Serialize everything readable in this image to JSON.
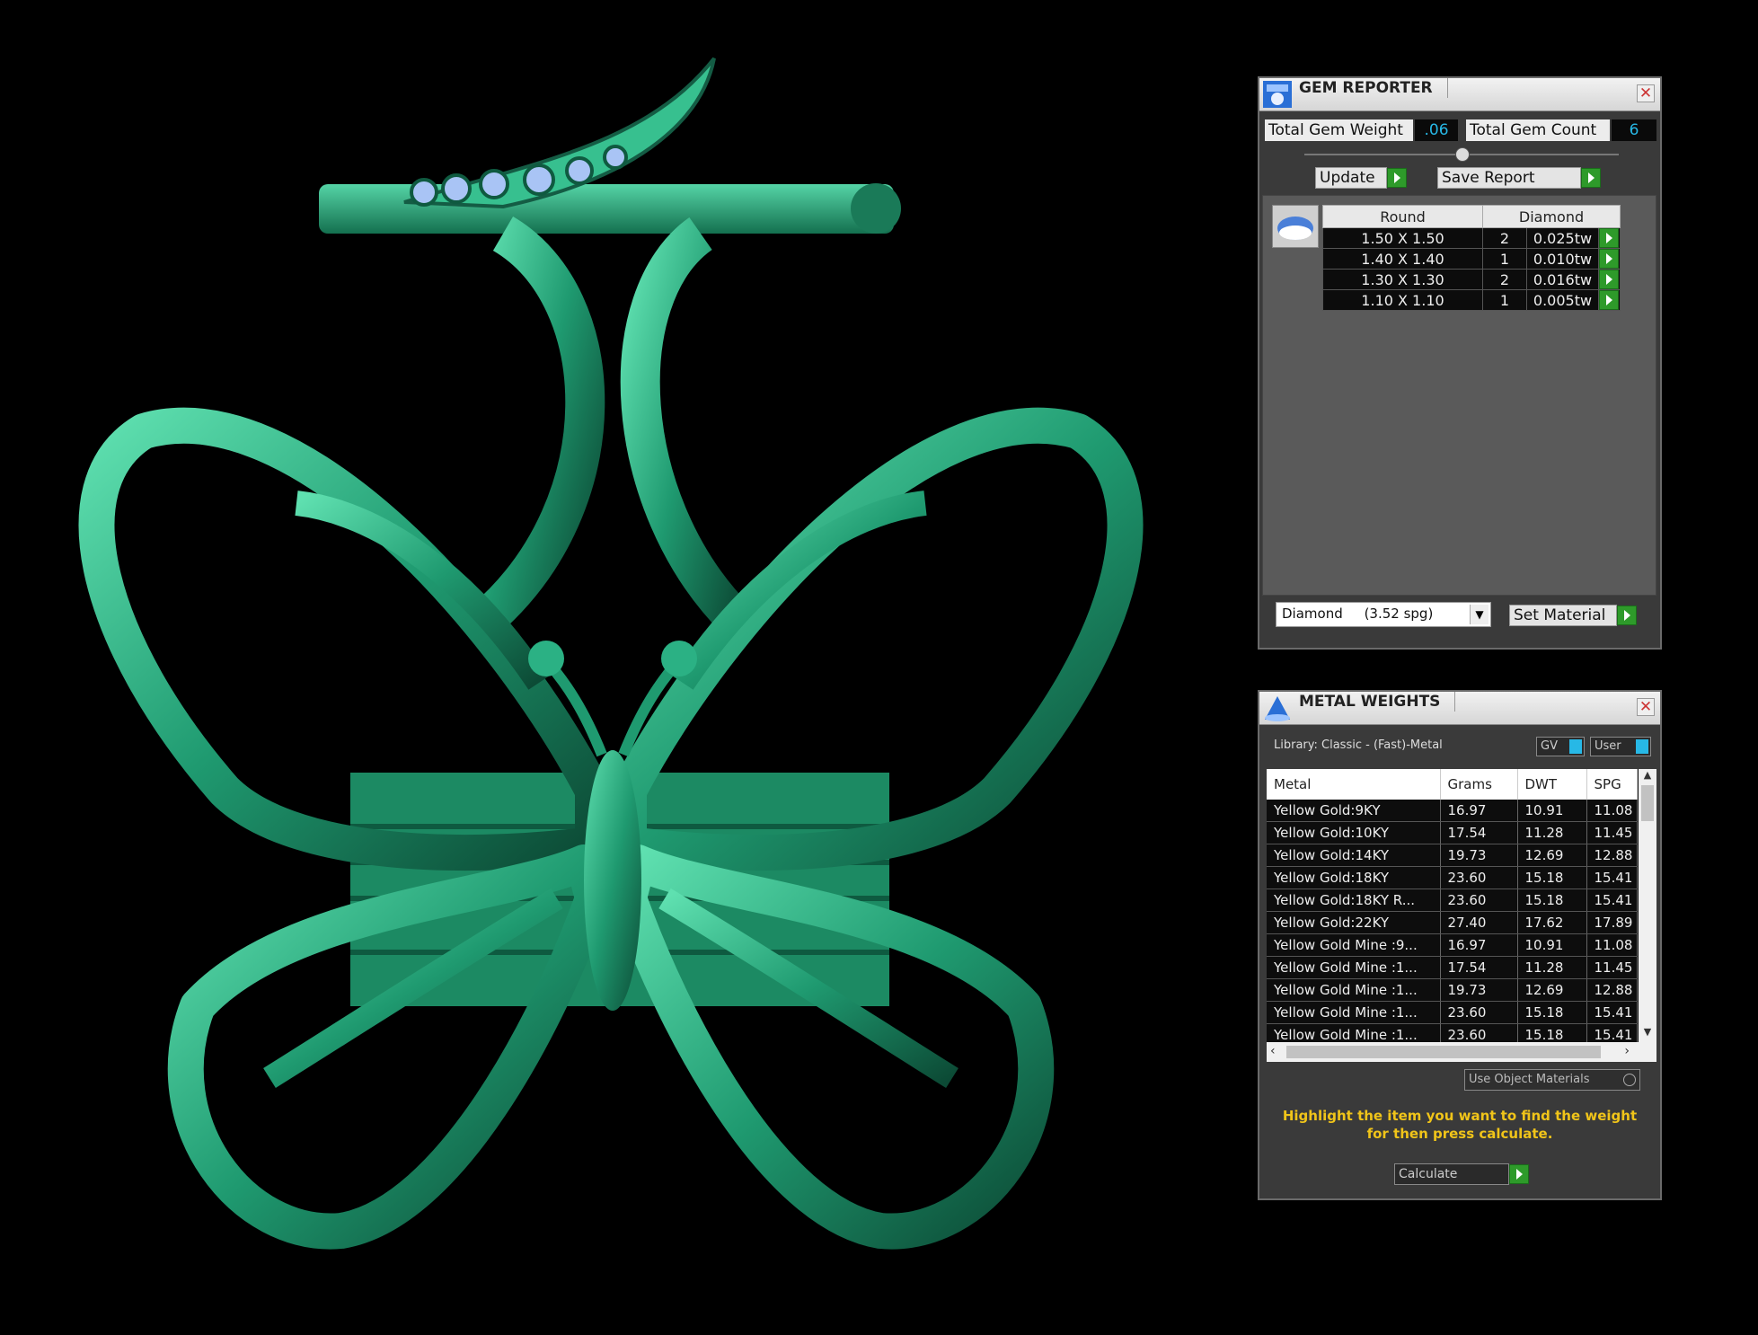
{
  "gem_reporter": {
    "title": "GEM REPORTER",
    "total_weight_label": "Total Gem Weight",
    "total_weight_value": ".06",
    "total_count_label": "Total Gem Count",
    "total_count_value": "6",
    "update_label": "Update",
    "save_report_label": "Save Report",
    "table_headers": [
      "Round",
      "Diamond"
    ],
    "rows": [
      {
        "size": "1.50 X 1.50",
        "count": "2",
        "weight": "0.025tw"
      },
      {
        "size": "1.40 X 1.40",
        "count": "1",
        "weight": "0.010tw"
      },
      {
        "size": "1.30 X 1.30",
        "count": "2",
        "weight": "0.016tw"
      },
      {
        "size": "1.10 X 1.10",
        "count": "1",
        "weight": "0.005tw"
      }
    ],
    "material_select": "Diamond     (3.52 spg)",
    "set_material_label": "Set Material"
  },
  "metal_weights": {
    "title": "METAL WEIGHTS",
    "library_label": "Library: Classic - (Fast)-Metal",
    "gv_label": "GV",
    "user_label": "User",
    "columns": [
      "Metal",
      "Grams",
      "DWT",
      "SPG"
    ],
    "rows": [
      {
        "metal": "Yellow Gold:9KY",
        "grams": "16.97",
        "dwt": "10.91",
        "spg": "11.08"
      },
      {
        "metal": "Yellow Gold:10KY",
        "grams": "17.54",
        "dwt": "11.28",
        "spg": "11.45"
      },
      {
        "metal": "Yellow Gold:14KY",
        "grams": "19.73",
        "dwt": "12.69",
        "spg": "12.88"
      },
      {
        "metal": "Yellow Gold:18KY",
        "grams": "23.60",
        "dwt": "15.18",
        "spg": "15.41"
      },
      {
        "metal": "Yellow Gold:18KY R...",
        "grams": "23.60",
        "dwt": "15.18",
        "spg": "15.41"
      },
      {
        "metal": "Yellow Gold:22KY",
        "grams": "27.40",
        "dwt": "17.62",
        "spg": "17.89"
      },
      {
        "metal": "Yellow Gold Mine :9...",
        "grams": "16.97",
        "dwt": "10.91",
        "spg": "11.08"
      },
      {
        "metal": "Yellow Gold Mine :1...",
        "grams": "17.54",
        "dwt": "11.28",
        "spg": "11.45"
      },
      {
        "metal": "Yellow Gold Mine :1...",
        "grams": "19.73",
        "dwt": "12.69",
        "spg": "12.88"
      },
      {
        "metal": "Yellow Gold Mine :1...",
        "grams": "23.60",
        "dwt": "15.18",
        "spg": "15.41"
      },
      {
        "metal": "Yellow Gold Mine :1...",
        "grams": "23.60",
        "dwt": "15.18",
        "spg": "15.41"
      }
    ],
    "use_object_materials_label": "Use Object Materials",
    "hint_line1": "Highlight the item you want to find the weight",
    "hint_line2": "for then press calculate.",
    "calculate_label": "Calculate"
  },
  "colors": {
    "model_green": "#2a9e76",
    "accent_go": "#2e9a2a",
    "value_blue": "#27b8e6",
    "hint_yellow": "#f0c419"
  }
}
